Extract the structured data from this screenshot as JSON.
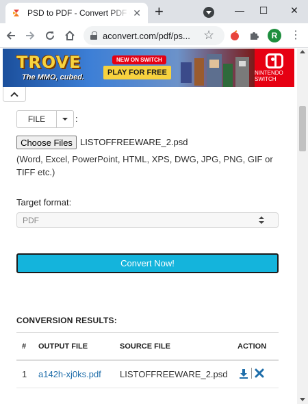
{
  "browser": {
    "tab_title": "PSD to PDF - Convert PDF online",
    "url": "aconvert.com/pdf/ps...",
    "new_tab_label": "+",
    "close_tab_label": "✕",
    "window_minimize_label": "—",
    "window_maximize_label": "☐",
    "window_close_label": "✕",
    "avatar_initial": "R"
  },
  "banner": {
    "logo_text": "TROVE",
    "tagline": "The MMO, cubed.",
    "badge": "NEW ON SWITCH",
    "cta": "PLAY FOR FREE",
    "platform_label": "NINTENDO SWITCH"
  },
  "form": {
    "file_mode_label": "FILE",
    "colon": ":",
    "choose_files_label": "Choose Files",
    "chosen_file": "LISTOFFREEWARE_2.psd",
    "formats_note": "(Word, Excel, PowerPoint, HTML, XPS, DWG, JPG, PNG, GIF or TIFF etc.)",
    "target_format_label": "Target format:",
    "target_format_value": "PDF",
    "convert_label": "Convert Now!"
  },
  "results": {
    "title": "CONVERSION RESULTS:",
    "columns": [
      "#",
      "OUTPUT FILE",
      "SOURCE FILE",
      "ACTION"
    ],
    "rows": [
      {
        "index": "1",
        "output_file": "a142h-xj0ks.pdf",
        "source_file": "LISTOFFREEWARE_2.psd"
      }
    ]
  },
  "colors": {
    "convert_button": "#14b4dc",
    "link": "#1f6eaa",
    "action_icon": "#1f6eaa"
  }
}
